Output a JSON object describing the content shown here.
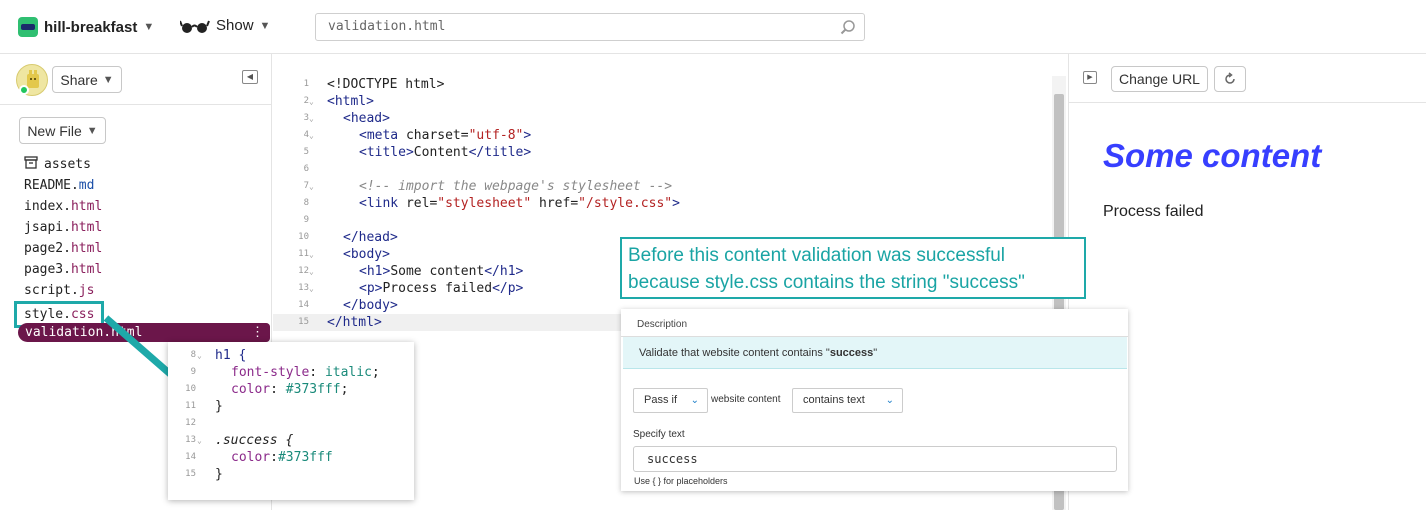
{
  "topbar": {
    "project_name": "hill-breakfast",
    "show_label": "Show",
    "search_value": "validation.html"
  },
  "sidebar": {
    "share_label": "Share",
    "new_file_label": "New File",
    "files": [
      {
        "base": "assets",
        "ext": ""
      },
      {
        "base": "README.",
        "ext": "md"
      },
      {
        "base": "index.",
        "ext": "html"
      },
      {
        "base": "jsapi.",
        "ext": "html"
      },
      {
        "base": "page2.",
        "ext": "html"
      },
      {
        "base": "page3.",
        "ext": "html"
      },
      {
        "base": "script.",
        "ext": "js"
      },
      {
        "base": "style.",
        "ext": "css"
      }
    ],
    "selected_file": "validation.html",
    "kebab": "⋮"
  },
  "editor": {
    "line_numbers": [
      "1",
      "2",
      "3",
      "4",
      "5",
      "6",
      "7",
      "8",
      "9",
      "10",
      "11",
      "12",
      "13",
      "14",
      "15"
    ],
    "lines": [
      "<!DOCTYPE html>",
      "<html>",
      "<head>",
      "<meta charset=\"utf-8\">",
      "<title>Content</title>",
      "",
      "<!-- import the webpage's stylesheet -->",
      "<link rel=\"stylesheet\" href=\"/style.css\">",
      "",
      "</head>",
      "<body>",
      "<h1>Some content</h1>",
      "<p>Process failed</p>",
      "</body>",
      "</html>"
    ]
  },
  "css_popup": {
    "line_numbers": [
      "8",
      "9",
      "10",
      "11",
      "12",
      "13",
      "14",
      "15"
    ],
    "lines": [
      "h1 {",
      "font-style: italic;",
      "color: #373fff;",
      "}",
      "",
      ".success {",
      "color:#373fff",
      "}"
    ]
  },
  "callout": {
    "line1": "Before this content validation was successful",
    "line2": "because style.css contains the string \"success\""
  },
  "validation": {
    "description_label": "Description",
    "description_prefix": "Validate that website content contains \"",
    "description_bold": "success",
    "description_suffix": "\"",
    "condition": "Pass if",
    "subject": "website content",
    "operator": "contains text",
    "specify_label": "Specify text",
    "input_value": "success",
    "hint": "Use { } for placeholders"
  },
  "preview": {
    "change_url_label": "Change URL",
    "heading": "Some content",
    "paragraph": "Process failed"
  },
  "colors": {
    "accent": "#1ea9a9",
    "selected_file_bg": "#6b164a",
    "heading_blue": "#373fff"
  }
}
